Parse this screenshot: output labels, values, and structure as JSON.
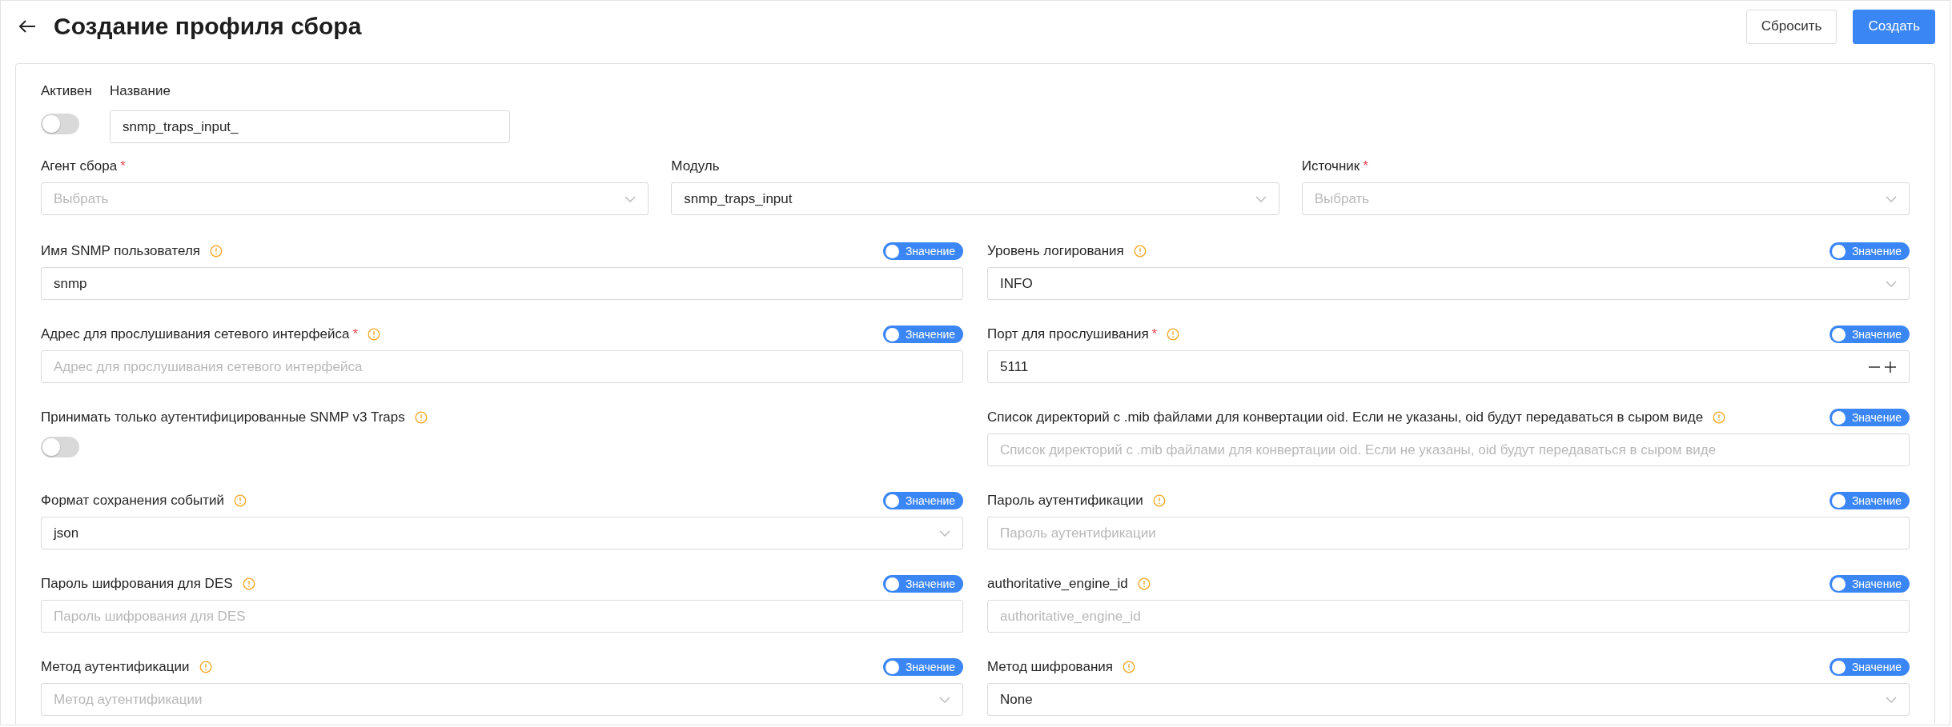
{
  "header": {
    "title": "Создание профиля сбора",
    "buttons": [
      {
        "label": "Сбросить",
        "kind": "secondary"
      },
      {
        "label": "Создать",
        "kind": "primary"
      }
    ]
  },
  "top": {
    "active": {
      "label": "Активен",
      "on": false
    },
    "name": {
      "label": "Название",
      "value": "snmp_traps_input_"
    }
  },
  "selects": [
    {
      "label": "Агент сбора",
      "required_mark": "*",
      "placeholder": "Выбрать"
    },
    {
      "label": "Модуль",
      "value": "snmp_traps_input"
    },
    {
      "label": "Источник",
      "required_mark": "*",
      "placeholder": "Выбрать"
    }
  ],
  "fields": [
    {
      "label": "Имя SNMP пользователя",
      "kind": "input",
      "value": "snmp",
      "toggle": {
        "label": "Значение",
        "on": true
      }
    },
    {
      "label": "Уровень логирования",
      "kind": "select",
      "value": "INFO",
      "toggle": {
        "label": "Значение",
        "on": true
      }
    },
    {
      "label": "Адрес для прослушивания сетевого интерфейса",
      "kind": "input",
      "required_mark": "*",
      "placeholder": "Адрес для прослушивания сетевого интерфейса",
      "toggle": {
        "label": "Значение",
        "on": true
      }
    },
    {
      "label": "Порт для прослушивания",
      "kind": "number",
      "required_mark": "*",
      "value": "5111",
      "toggle": {
        "label": "Значение",
        "on": true
      }
    },
    {
      "label": "Принимать только аутентифицированные SNMP v3 Traps",
      "kind": "switch",
      "on": false
    },
    {
      "label": "Список директорий с .mib файлами для конвертации oid. Если не указаны, oid будут передаваться в сыром виде",
      "kind": "input",
      "placeholder": "Список директорий с .mib файлами для конвертации oid. Если не указаны, oid будут передаваться в сыром виде",
      "toggle": {
        "label": "Значение",
        "on": true
      }
    },
    {
      "label": "Формат сохранения событий",
      "kind": "select",
      "value": "json",
      "toggle": {
        "label": "Значение",
        "on": true
      }
    },
    {
      "label": "Пароль аутентификации",
      "kind": "input",
      "placeholder": "Пароль аутентификации",
      "toggle": {
        "label": "Значение",
        "on": true
      }
    },
    {
      "label": "Пароль шифрования для DES",
      "kind": "input",
      "placeholder": "Пароль шифрования для DES",
      "toggle": {
        "label": "Значение",
        "on": true
      }
    },
    {
      "label": "authoritative_engine_id",
      "kind": "input",
      "placeholder": "authoritative_engine_id",
      "toggle": {
        "label": "Значение",
        "on": true
      }
    },
    {
      "label": "Метод аутентификации",
      "kind": "select",
      "placeholder": "Метод аутентификации",
      "toggle": {
        "label": "Значение",
        "on": true
      }
    },
    {
      "label": "Метод шифрования",
      "kind": "select",
      "value": "None",
      "toggle": {
        "label": "Значение",
        "on": true
      }
    }
  ]
}
